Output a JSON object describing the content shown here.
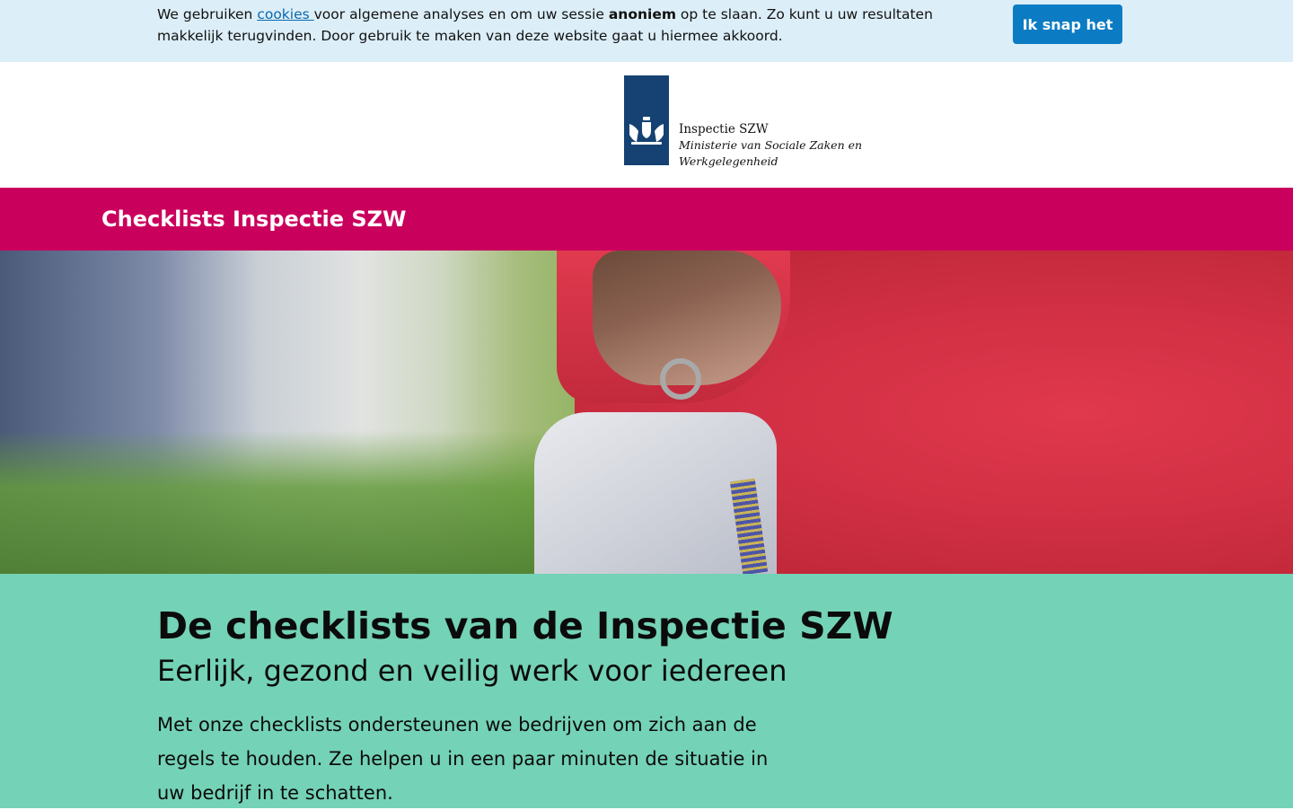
{
  "cookie_bar": {
    "text_before_link": "We gebruiken ",
    "link_label": "cookies ",
    "text_after_link": "voor algemene analyses en om uw sessie ",
    "bold_word": "anoniem",
    "text_end": " op te slaan. Zo kunt u uw resultaten makkelijk terugvinden. Door gebruik te maken van deze website gaat u hiermee akkoord.",
    "button_label": "Ik snap het",
    "colors": {
      "background": "#dceef8",
      "button": "#0b7cc4",
      "link": "#0b69b0"
    }
  },
  "header": {
    "logo_icon": "rijksoverheid-coat-of-arms-icon",
    "logo_line1": "Inspectie SZW",
    "logo_line2": "Ministerie van Sociale Zaken en",
    "logo_line3": "Werkgelegenheid",
    "colors": {
      "logo_block": "#154273"
    }
  },
  "nav": {
    "title": "Checklists Inspectie SZW",
    "colors": {
      "background": "#ca005d"
    }
  },
  "hero": {
    "image_description_icon": "hero-photo-hand-with-phone-and-glove"
  },
  "intro": {
    "heading": "De checklists van de Inspectie SZW",
    "subheading": "Eerlijk, gezond en veilig werk voor iedereen",
    "body": "Met onze checklists ondersteunen we bedrijven om zich aan de regels te houden. Ze helpen u in een paar minuten de situatie in uw bedrijf in te schatten.",
    "colors": {
      "background": "#74d2b6"
    }
  }
}
